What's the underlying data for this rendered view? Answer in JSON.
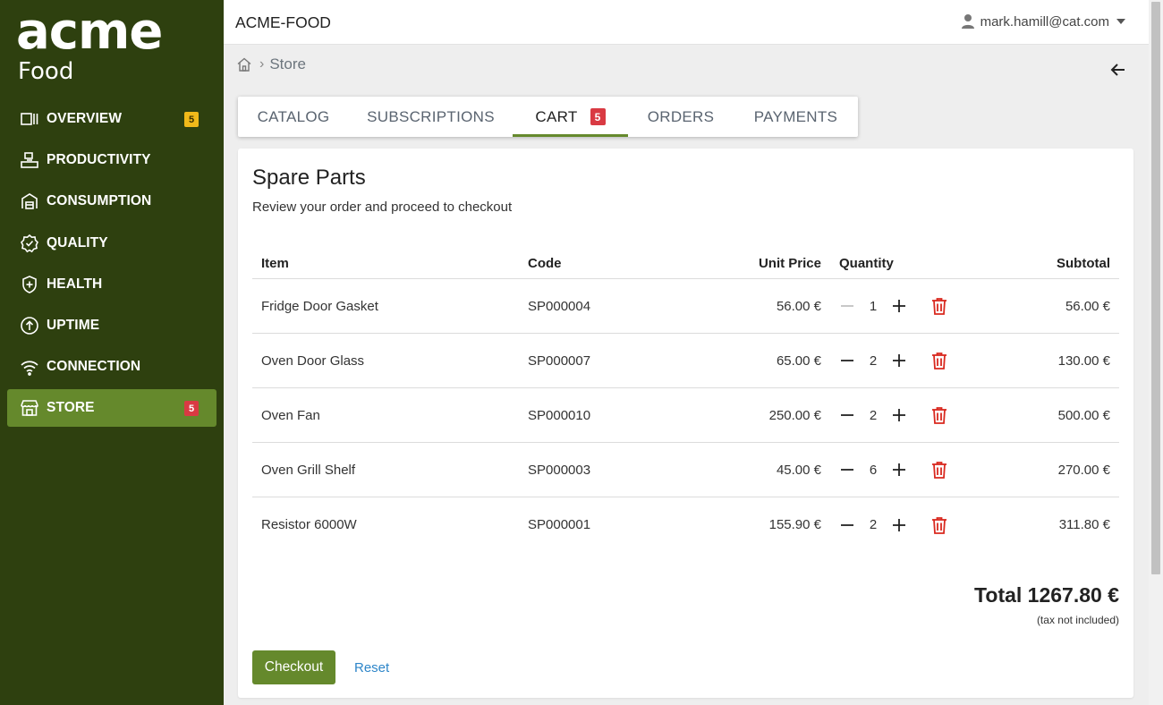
{
  "brand": {
    "logo_word": "acme",
    "logo_sub": "Food"
  },
  "header": {
    "app_title": "ACME-FOOD",
    "user_email": "mark.hamill@cat.com"
  },
  "sidebar": {
    "items": [
      {
        "label": "OVERVIEW",
        "icon": "overview-icon",
        "badge": "5",
        "badge_color": "#f0b91a"
      },
      {
        "label": "PRODUCTIVITY",
        "icon": "productivity-icon"
      },
      {
        "label": "CONSUMPTION",
        "icon": "consumption-icon"
      },
      {
        "label": "QUALITY",
        "icon": "quality-icon"
      },
      {
        "label": "HEALTH",
        "icon": "health-icon"
      },
      {
        "label": "UPTIME",
        "icon": "uptime-icon"
      },
      {
        "label": "CONNECTION",
        "icon": "wifi-icon"
      },
      {
        "label": "STORE",
        "icon": "store-icon",
        "badge": "5",
        "badge_color": "#d93a43",
        "active": true
      }
    ]
  },
  "breadcrumb": {
    "current": "Store"
  },
  "tabs": [
    {
      "label": "CATALOG"
    },
    {
      "label": "SUBSCRIPTIONS"
    },
    {
      "label": "CART",
      "badge": "5",
      "active": true
    },
    {
      "label": "ORDERS"
    },
    {
      "label": "PAYMENTS"
    }
  ],
  "cart": {
    "title": "Spare Parts",
    "subtitle": "Review your order and proceed to checkout",
    "columns": {
      "item": "Item",
      "code": "Code",
      "unit_price": "Unit Price",
      "quantity": "Quantity",
      "subtotal": "Subtotal"
    },
    "rows": [
      {
        "item": "Fridge Door Gasket",
        "code": "SP000004",
        "unit_price": "56.00 €",
        "quantity": "1",
        "subtotal": "56.00 €"
      },
      {
        "item": "Oven Door Glass",
        "code": "SP000007",
        "unit_price": "65.00 €",
        "quantity": "2",
        "subtotal": "130.00 €"
      },
      {
        "item": "Oven Fan",
        "code": "SP000010",
        "unit_price": "250.00 €",
        "quantity": "2",
        "subtotal": "500.00 €"
      },
      {
        "item": "Oven Grill Shelf",
        "code": "SP000003",
        "unit_price": "45.00 €",
        "quantity": "6",
        "subtotal": "270.00 €"
      },
      {
        "item": "Resistor 6000W",
        "code": "SP000001",
        "unit_price": "155.90 €",
        "quantity": "2",
        "subtotal": "311.80 €"
      }
    ],
    "total": "Total 1267.80 €",
    "tax_note": "(tax not included)",
    "checkout_label": "Checkout",
    "reset_label": "Reset"
  },
  "colors": {
    "sidebar_bg": "#2e400f",
    "accent": "#65892c",
    "danger": "#d93a43",
    "link": "#2e86c9"
  }
}
